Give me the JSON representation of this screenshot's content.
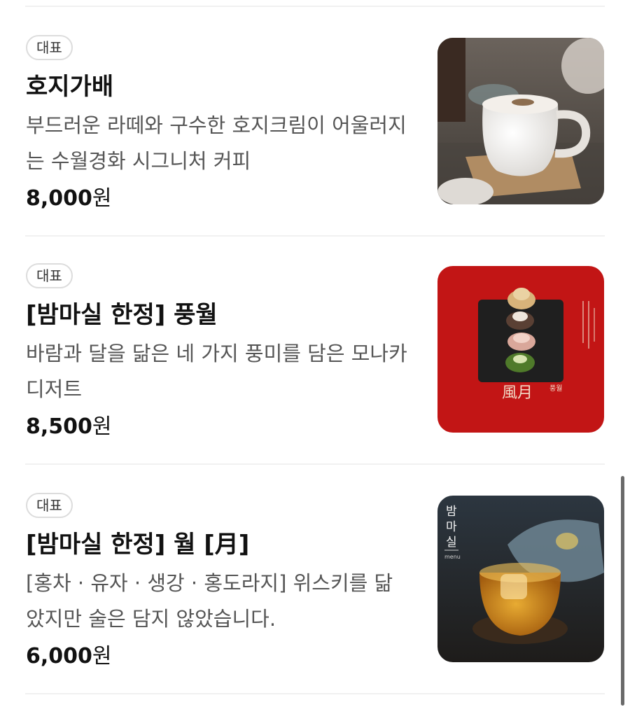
{
  "menu": {
    "items": [
      {
        "badge": "대표",
        "title": "호지가배",
        "description": "부드러운 라떼와 구수한 호지크림이 어울러지는 수월경화 시그니처 커피",
        "price_number": "8,000",
        "price_unit": "원",
        "image": "hojicha-latte-photo"
      },
      {
        "badge": "대표",
        "title": "[밤마실 한정] 풍월",
        "description": "바람과 달을 닮은 네 가지 풍미를 담은 모나카 디저트",
        "price_number": "8,500",
        "price_unit": "원",
        "image": "monaka-dessert-photo",
        "image_text": {
          "hanja": "風月",
          "hangul": "풍월"
        }
      },
      {
        "badge": "대표",
        "title": "[밤마실 한정] 월 [月]",
        "description": "[홍차 · 유자 · 생강 · 홍도라지] 위스키를 닮았지만 술은 담지 않았습니다.",
        "price_number": "6,000",
        "price_unit": "원",
        "image": "yuzu-tea-drink-photo",
        "image_text": {
          "logo": "밤마실",
          "sub": "menu"
        }
      }
    ]
  },
  "colors": {
    "text": "#111111",
    "description": "#555555",
    "badge_border": "#dcdcdc",
    "divider": "#f1f1f1",
    "red_background": "#c21515"
  }
}
